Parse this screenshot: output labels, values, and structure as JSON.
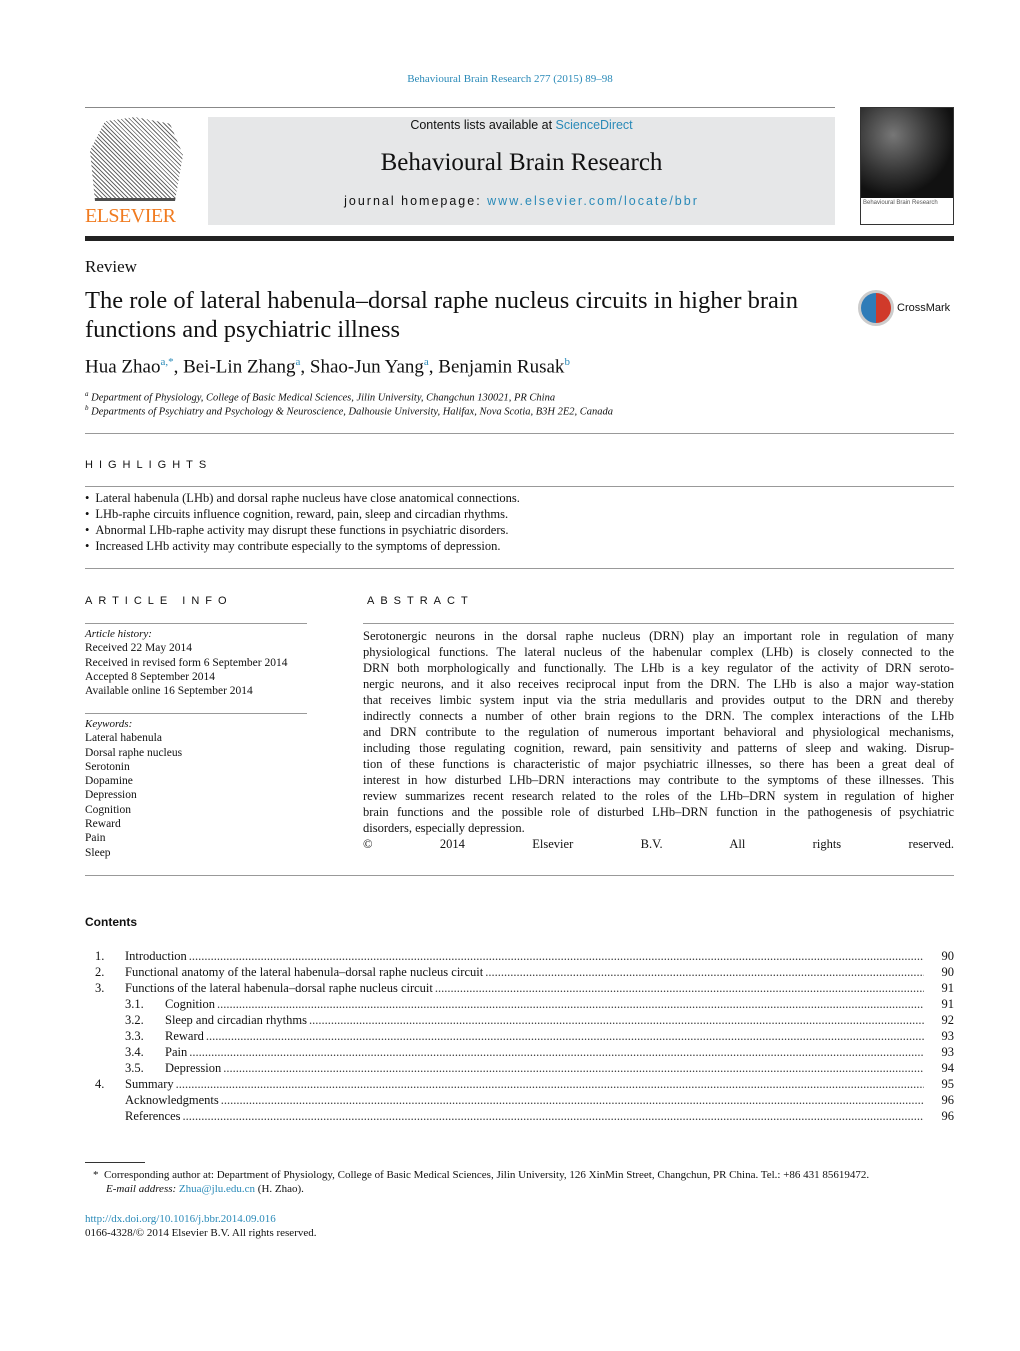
{
  "journal_ref": "Behavioural Brain Research 277 (2015) 89–98",
  "header": {
    "contents_prefix": "Contents lists available at ",
    "contents_link": "ScienceDirect",
    "journal_title": "Behavioural Brain Research",
    "homepage_prefix": "journal homepage: ",
    "homepage_link": "www.elsevier.com/locate/bbr",
    "publisher": "ELSEVIER",
    "cover_text": "Behavioural Brain Research"
  },
  "article_type": "Review",
  "title": "The role of lateral habenula–dorsal raphe nucleus circuits in higher brain functions and psychiatric illness",
  "crossmark": "CrossMark",
  "authors": [
    {
      "name": "Hua Zhao",
      "sup": "a,*"
    },
    {
      "name": "Bei-Lin Zhang",
      "sup": "a"
    },
    {
      "name": "Shao-Jun Yang",
      "sup": "a"
    },
    {
      "name": "Benjamin Rusak",
      "sup": "b"
    }
  ],
  "affiliations": [
    {
      "sup": "a",
      "text": "Department of Physiology, College of Basic Medical Sciences, Jilin University, Changchun 130021, PR China"
    },
    {
      "sup": "b",
      "text": "Departments of Psychiatry and Psychology & Neuroscience, Dalhousie University, Halifax, Nova Scotia, B3H 2E2, Canada"
    }
  ],
  "highlights": {
    "heading": "HIGHLIGHTS",
    "items": [
      "Lateral habenula (LHb) and dorsal raphe nucleus have close anatomical connections.",
      "LHb-raphe circuits influence cognition, reward, pain, sleep and circadian rhythms.",
      "Abnormal LHb-raphe activity may disrupt these functions in psychiatric disorders.",
      "Increased LHb activity may contribute especially to the symptoms of depression."
    ]
  },
  "article_info": {
    "heading": "ARTICLE INFO",
    "history_label": "Article history:",
    "history": [
      "Received 22 May 2014",
      "Received in revised form 6 September 2014",
      "Accepted 8 September 2014",
      "Available online 16 September 2014"
    ],
    "keywords_label": "Keywords:",
    "keywords": [
      "Lateral habenula",
      "Dorsal raphe nucleus",
      "Serotonin",
      "Dopamine",
      "Depression",
      "Cognition",
      "Reward",
      "Pain",
      "Sleep"
    ]
  },
  "abstract": {
    "heading": "ABSTRACT",
    "lines": [
      "Serotonergic neurons in the dorsal raphe nucleus (DRN) play an important role in regulation of many",
      "physiological functions. The lateral nucleus of the habenular complex (LHb) is closely connected to the",
      "DRN both morphologically and functionally. The LHb is a key regulator of the activity of DRN seroto-",
      "nergic neurons, and it also receives reciprocal input from the DRN. The LHb is also a major way-station",
      "that receives limbic system input via the stria medullaris and provides output to the DRN and thereby",
      "indirectly connects a number of other brain regions to the DRN. The complex interactions of the LHb",
      "and DRN contribute to the regulation of numerous important behavioral and physiological mechanisms,",
      "including those regulating cognition, reward, pain sensitivity and patterns of sleep and waking. Disrup-",
      "tion of these functions is characteristic of major psychiatric illnesses, so there has been a great deal of",
      "interest in how disturbed LHb–DRN interactions may contribute to the symptoms of these illnesses. This",
      "review summarizes recent research related to the roles of the LHb–DRN system in regulation of higher",
      "brain functions and the possible role of disturbed LHb–DRN function in the pathogenesis of psychiatric",
      "disorders, especially depression."
    ],
    "copyright": "© 2014 Elsevier B.V. All rights reserved."
  },
  "contents": {
    "heading": "Contents",
    "items": [
      {
        "num": "1.",
        "label": "Introduction",
        "page": "90"
      },
      {
        "num": "2.",
        "label": "Functional anatomy of the lateral habenula–dorsal raphe nucleus circuit",
        "page": "90"
      },
      {
        "num": "3.",
        "label": "Functions of the lateral habenula–dorsal raphe nucleus circuit",
        "page": "91"
      },
      {
        "num": "3.1.",
        "label": "Cognition",
        "page": "91",
        "sub": true
      },
      {
        "num": "3.2.",
        "label": "Sleep and circadian rhythms",
        "page": "92",
        "sub": true
      },
      {
        "num": "3.3.",
        "label": "Reward",
        "page": "93",
        "sub": true
      },
      {
        "num": "3.4.",
        "label": "Pain",
        "page": "93",
        "sub": true
      },
      {
        "num": "3.5.",
        "label": "Depression",
        "page": "94",
        "sub": true
      },
      {
        "num": "4.",
        "label": "Summary",
        "page": "95"
      },
      {
        "num": "",
        "label": "Acknowledgments",
        "page": "96"
      },
      {
        "num": "",
        "label": "References",
        "page": "96"
      }
    ]
  },
  "footnote": {
    "mark": "*",
    "text": "Corresponding author at: Department of Physiology, College of Basic Medical Sciences, Jilin University, 126 XinMin Street, Changchun, PR China. Tel.: +86 431 85619472.",
    "email_label": "E-mail address:",
    "email": "Zhua@jlu.edu.cn",
    "email_suffix": " (H. Zhao)."
  },
  "doi": "http://dx.doi.org/10.1016/j.bbr.2014.09.016",
  "issn_line": "0166-4328/© 2014 Elsevier B.V. All rights reserved."
}
